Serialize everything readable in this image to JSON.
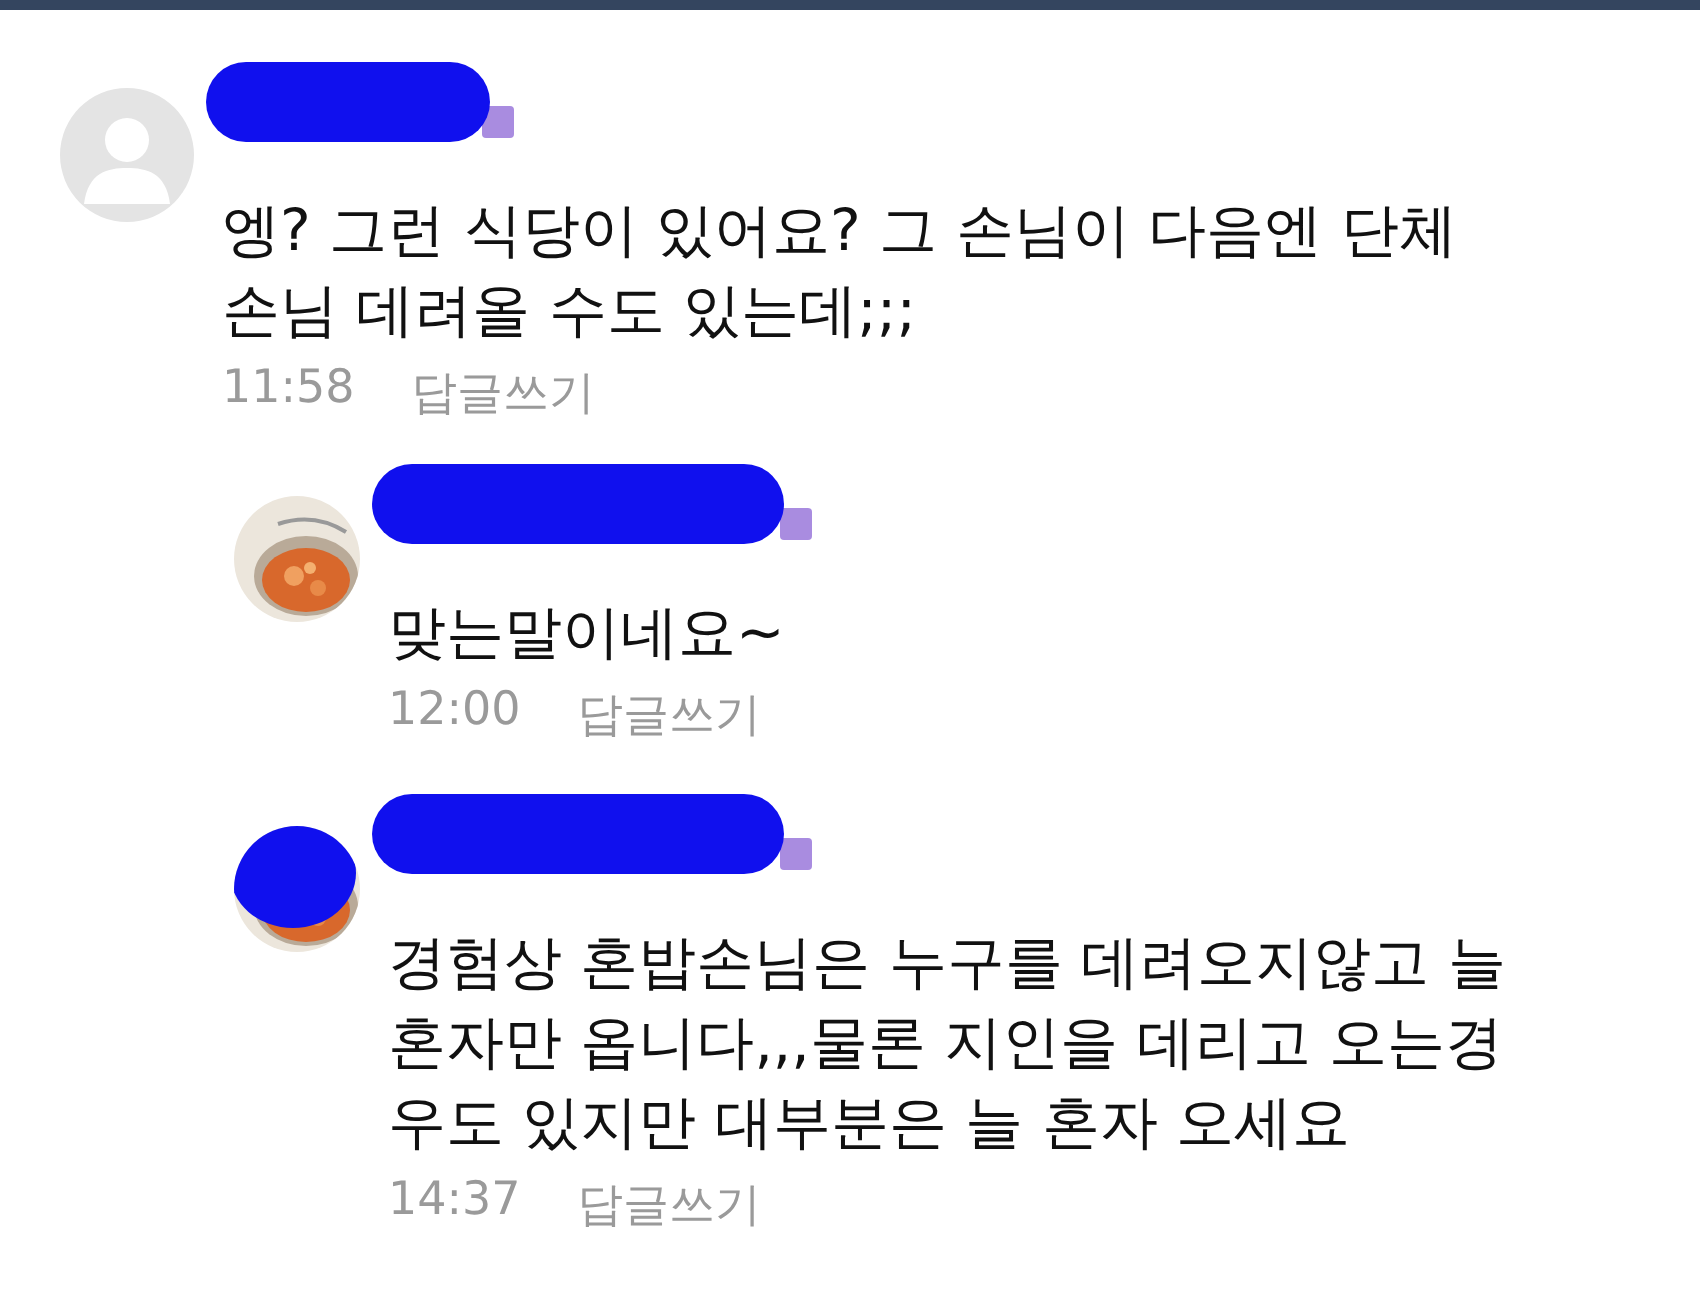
{
  "comments": [
    {
      "kind": "top",
      "avatar": {
        "kind": "default",
        "redacted": false
      },
      "redacted": true,
      "lines": [
        "엥? 그런 식당이 있어요? 그 손님이 다음엔 단체",
        "손님 데려올 수도 있는데;;;"
      ],
      "time": "11:58",
      "reply_label": "답글쓰기"
    },
    {
      "kind": "reply",
      "avatar": {
        "kind": "picture",
        "redacted": false
      },
      "redacted": true,
      "lines": [
        "맞는말이네요~"
      ],
      "time": "12:00",
      "reply_label": "답글쓰기"
    },
    {
      "kind": "reply",
      "avatar": {
        "kind": "picture",
        "redacted": true
      },
      "redacted": true,
      "lines": [
        "경험상 혼밥손님은 누구를 데려오지않고 늘",
        "혼자만 옵니다,,,물론 지인을 데리고 오는경",
        "우도 있지만 대부분은 늘 혼자 오세요"
      ],
      "time": "14:37",
      "reply_label": "답글쓰기"
    }
  ]
}
